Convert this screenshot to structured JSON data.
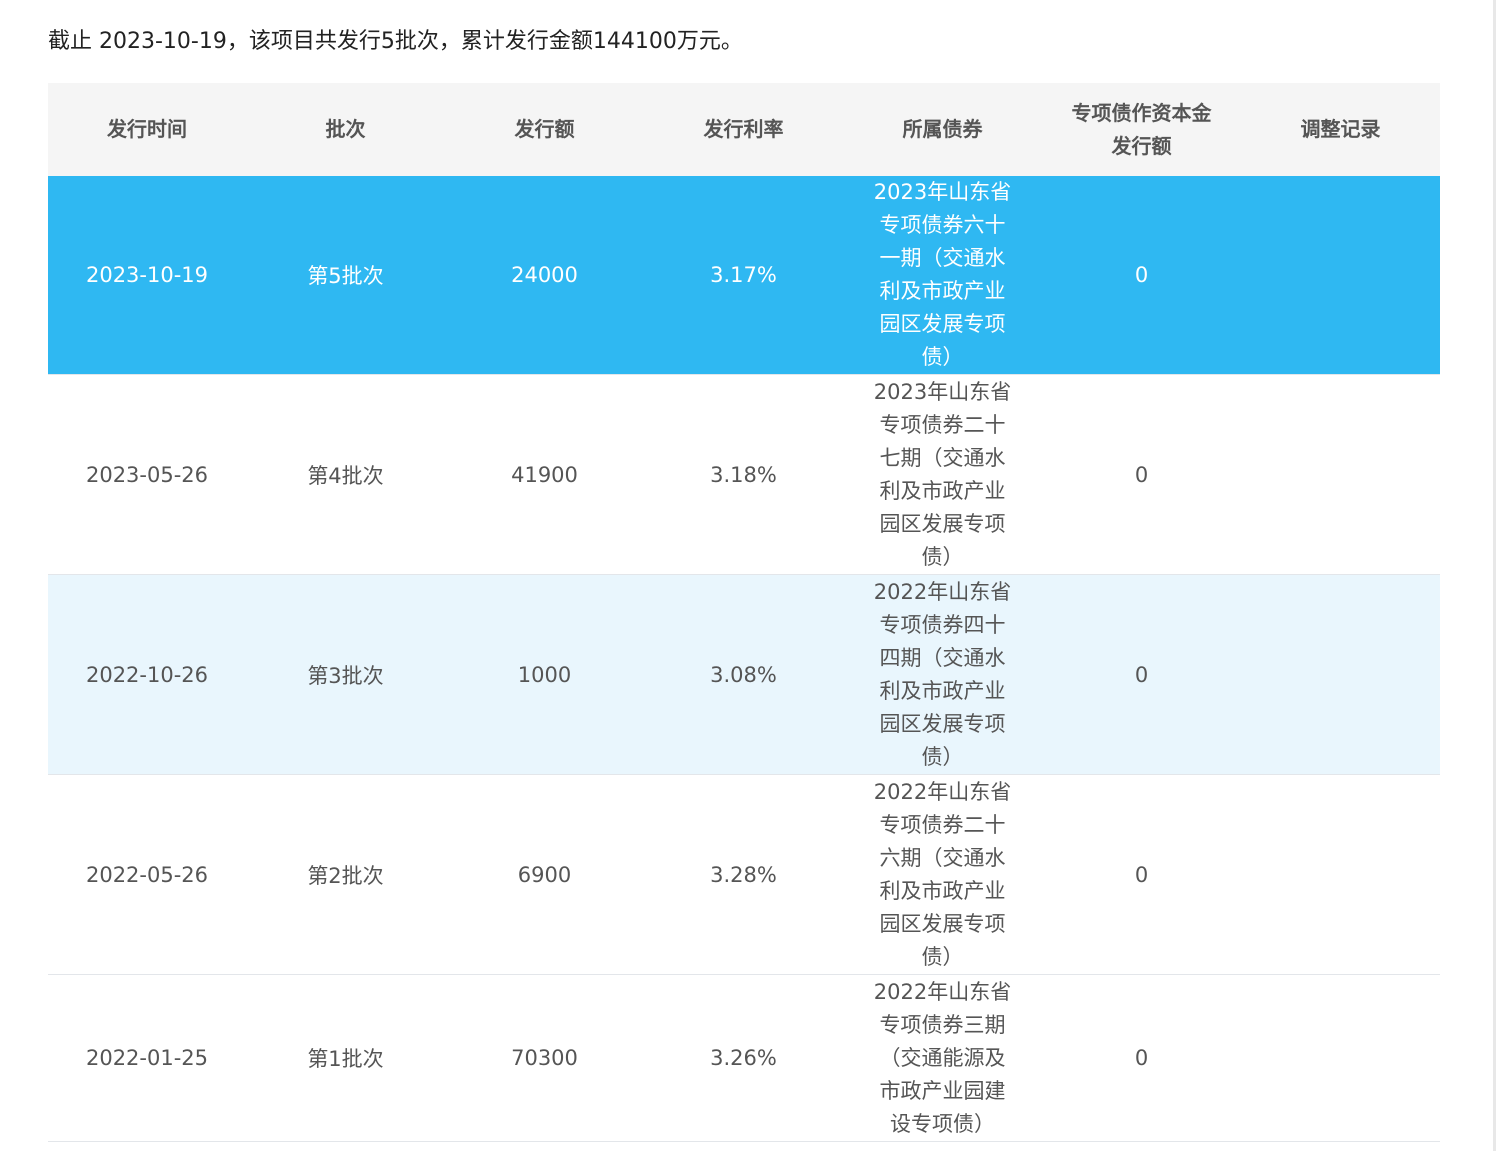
{
  "summary": "截止 2023-10-19，该项目共发行5批次，累计发行金额144100万元。",
  "table": {
    "headers": [
      "发行时间",
      "批次",
      "发行额",
      "发行利率",
      "所属债券",
      "专项债作资本金发行额",
      "调整记录"
    ],
    "rows": [
      {
        "date": "2023-10-19",
        "batch": "第5批次",
        "amount": "24000",
        "rate": "3.17%",
        "bond": "2023年山东省专项债券六十一期（交通水利及市政产业园区发展专项债）",
        "capital": "0",
        "adjust": ""
      },
      {
        "date": "2023-05-26",
        "batch": "第4批次",
        "amount": "41900",
        "rate": "3.18%",
        "bond": "2023年山东省专项债券二十七期（交通水利及市政产业园区发展专项债）",
        "capital": "0",
        "adjust": ""
      },
      {
        "date": "2022-10-26",
        "batch": "第3批次",
        "amount": "1000",
        "rate": "3.08%",
        "bond": "2022年山东省专项债券四十四期（交通水利及市政产业园区发展专项债）",
        "capital": "0",
        "adjust": ""
      },
      {
        "date": "2022-05-26",
        "batch": "第2批次",
        "amount": "6900",
        "rate": "3.28%",
        "bond": "2022年山东省专项债券二十六期（交通水利及市政产业园区发展专项债）",
        "capital": "0",
        "adjust": ""
      },
      {
        "date": "2022-01-25",
        "batch": "第1批次",
        "amount": "70300",
        "rate": "3.26%",
        "bond": "2022年山东省专项债券三期（交通能源及市政产业园建设专项债）",
        "capital": "0",
        "adjust": ""
      }
    ]
  },
  "colors": {
    "active_row": "#2fb8f2",
    "alt_row": "#e9f6fd",
    "header_bg": "#f5f5f5"
  }
}
